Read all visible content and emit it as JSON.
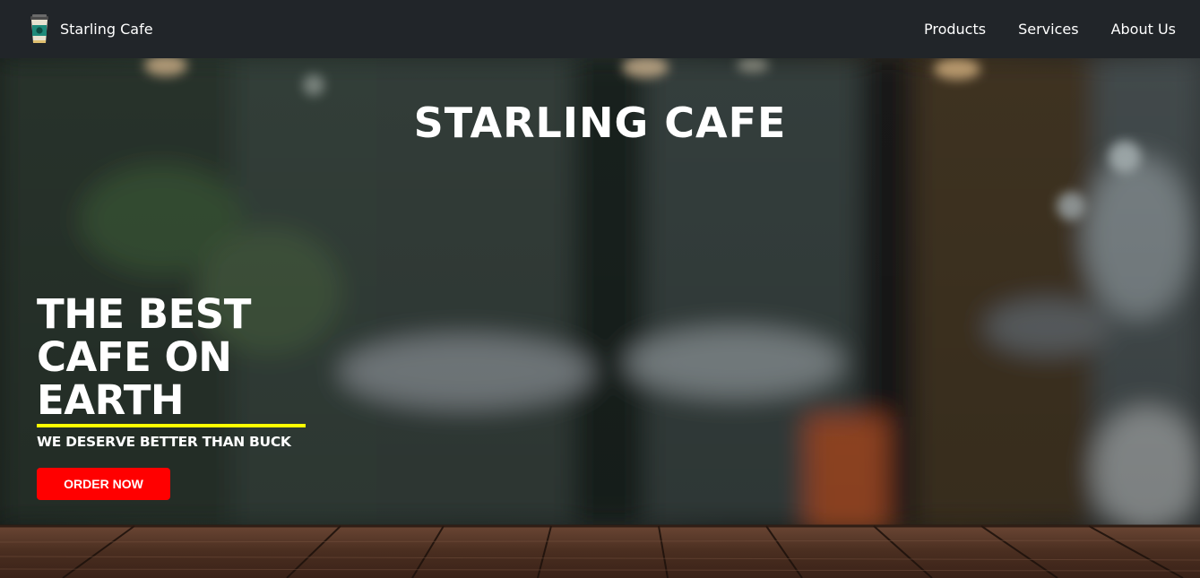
{
  "navbar": {
    "brand": "Starling Cafe",
    "logo_icon": "coffee-cup-icon",
    "links": [
      "Products",
      "Services",
      "About Us"
    ]
  },
  "hero": {
    "title": "STARLING CAFE",
    "tagline_lines": [
      "THE BEST",
      "CAFE ON",
      "EARTH"
    ],
    "subtagline": "WE DESERVE BETTER THAN BUCK",
    "cta_label": "ORDER NOW",
    "background": "blurred-cafe-interior-with-wooden-table"
  },
  "colors": {
    "navbar_bg": "#212529",
    "accent_underline": "#ffff00",
    "cta_bg": "#ff0000",
    "text": "#ffffff"
  }
}
